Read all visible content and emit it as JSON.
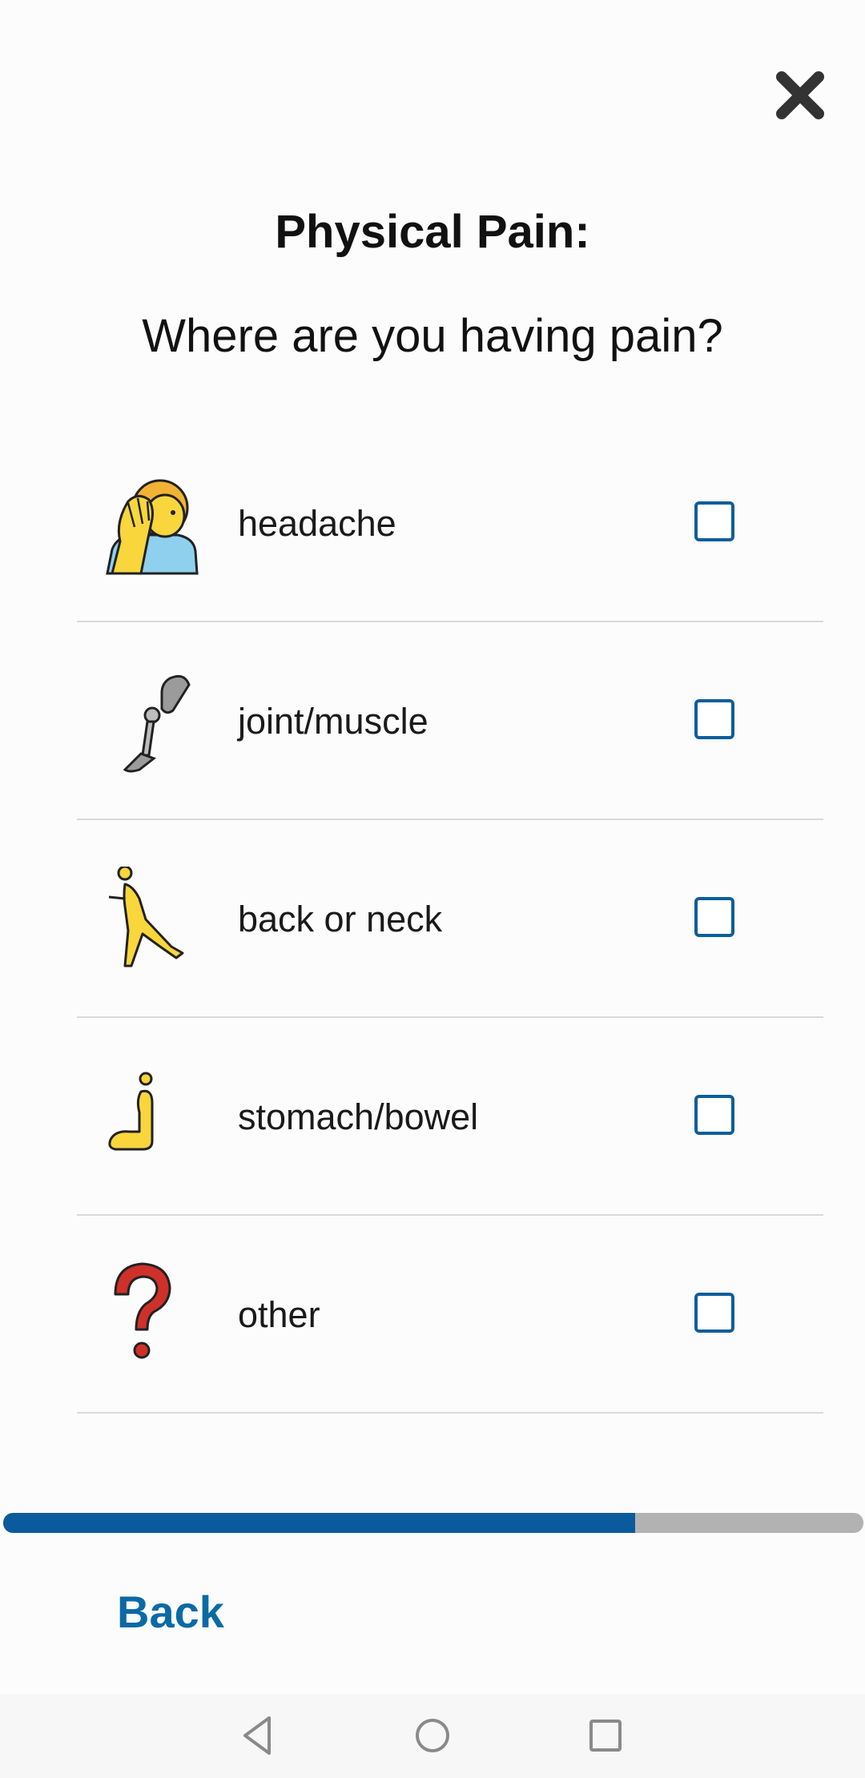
{
  "header": {
    "title": "Physical Pain:",
    "question": "Where are you having pain?"
  },
  "options": [
    {
      "label": "headache",
      "icon": "face-palm-person-icon",
      "checked": false
    },
    {
      "label": "joint/muscle",
      "icon": "prosthetic-leg-icon",
      "checked": false
    },
    {
      "label": "back or neck",
      "icon": "person-bending-icon",
      "checked": false
    },
    {
      "label": "stomach/bowel",
      "icon": "person-sitting-icon",
      "checked": false
    },
    {
      "label": "other",
      "icon": "question-mark-icon",
      "checked": false
    }
  ],
  "progress": {
    "fraction": 0.735
  },
  "footer": {
    "back_label": "Back"
  },
  "colors": {
    "accent": "#0b5a9c",
    "checkbox_border": "#0d5e9a",
    "back_text": "#0a6aa5",
    "progress_track": "#b2b2b2"
  },
  "icons": {
    "close": "close-x-icon",
    "nav_back": "nav-back-triangle-icon",
    "nav_home": "nav-home-circle-icon",
    "nav_recents": "nav-recents-square-icon"
  }
}
